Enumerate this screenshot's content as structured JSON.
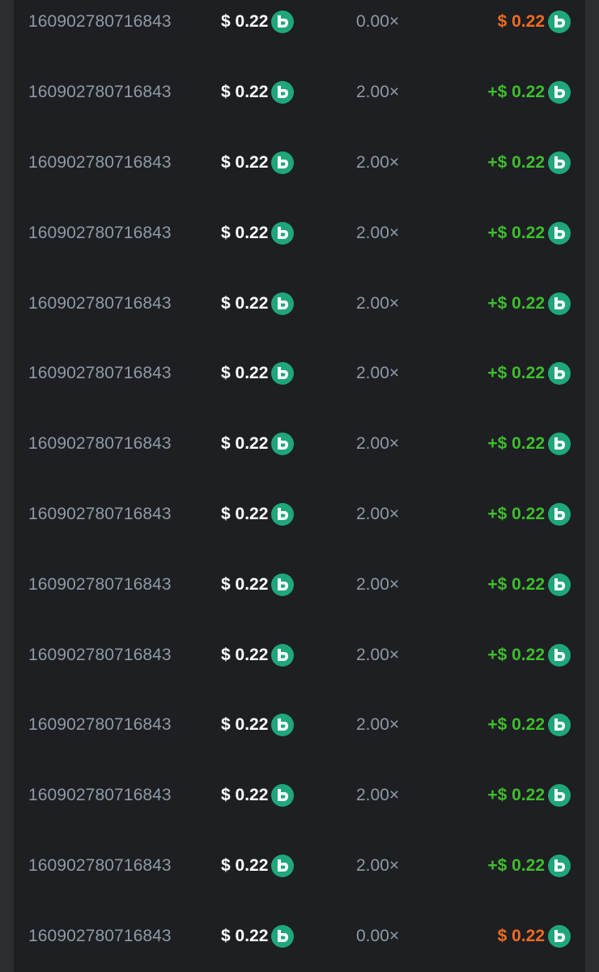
{
  "currency_icon": "bcd-coin-icon",
  "colors": {
    "background": "#1d1f22",
    "page": "#2b2d31",
    "id_text": "#8f9aa6",
    "amount_text": "#ffffff",
    "win": "#3fbe2d",
    "loss": "#ef6b1f",
    "coin": "#1fa77a"
  },
  "bets": [
    {
      "bet_id": "160902780716843",
      "amount": "$ 0.22",
      "multiplier": "0.00×",
      "payout": "$ 0.22",
      "result": "loss"
    },
    {
      "bet_id": "160902780716843",
      "amount": "$ 0.22",
      "multiplier": "2.00×",
      "payout": "+$ 0.22",
      "result": "win"
    },
    {
      "bet_id": "160902780716843",
      "amount": "$ 0.22",
      "multiplier": "2.00×",
      "payout": "+$ 0.22",
      "result": "win"
    },
    {
      "bet_id": "160902780716843",
      "amount": "$ 0.22",
      "multiplier": "2.00×",
      "payout": "+$ 0.22",
      "result": "win"
    },
    {
      "bet_id": "160902780716843",
      "amount": "$ 0.22",
      "multiplier": "2.00×",
      "payout": "+$ 0.22",
      "result": "win"
    },
    {
      "bet_id": "160902780716843",
      "amount": "$ 0.22",
      "multiplier": "2.00×",
      "payout": "+$ 0.22",
      "result": "win"
    },
    {
      "bet_id": "160902780716843",
      "amount": "$ 0.22",
      "multiplier": "2.00×",
      "payout": "+$ 0.22",
      "result": "win"
    },
    {
      "bet_id": "160902780716843",
      "amount": "$ 0.22",
      "multiplier": "2.00×",
      "payout": "+$ 0.22",
      "result": "win"
    },
    {
      "bet_id": "160902780716843",
      "amount": "$ 0.22",
      "multiplier": "2.00×",
      "payout": "+$ 0.22",
      "result": "win"
    },
    {
      "bet_id": "160902780716843",
      "amount": "$ 0.22",
      "multiplier": "2.00×",
      "payout": "+$ 0.22",
      "result": "win"
    },
    {
      "bet_id": "160902780716843",
      "amount": "$ 0.22",
      "multiplier": "2.00×",
      "payout": "+$ 0.22",
      "result": "win"
    },
    {
      "bet_id": "160902780716843",
      "amount": "$ 0.22",
      "multiplier": "2.00×",
      "payout": "+$ 0.22",
      "result": "win"
    },
    {
      "bet_id": "160902780716843",
      "amount": "$ 0.22",
      "multiplier": "2.00×",
      "payout": "+$ 0.22",
      "result": "win"
    },
    {
      "bet_id": "160902780716843",
      "amount": "$ 0.22",
      "multiplier": "0.00×",
      "payout": "$ 0.22",
      "result": "loss"
    }
  ]
}
